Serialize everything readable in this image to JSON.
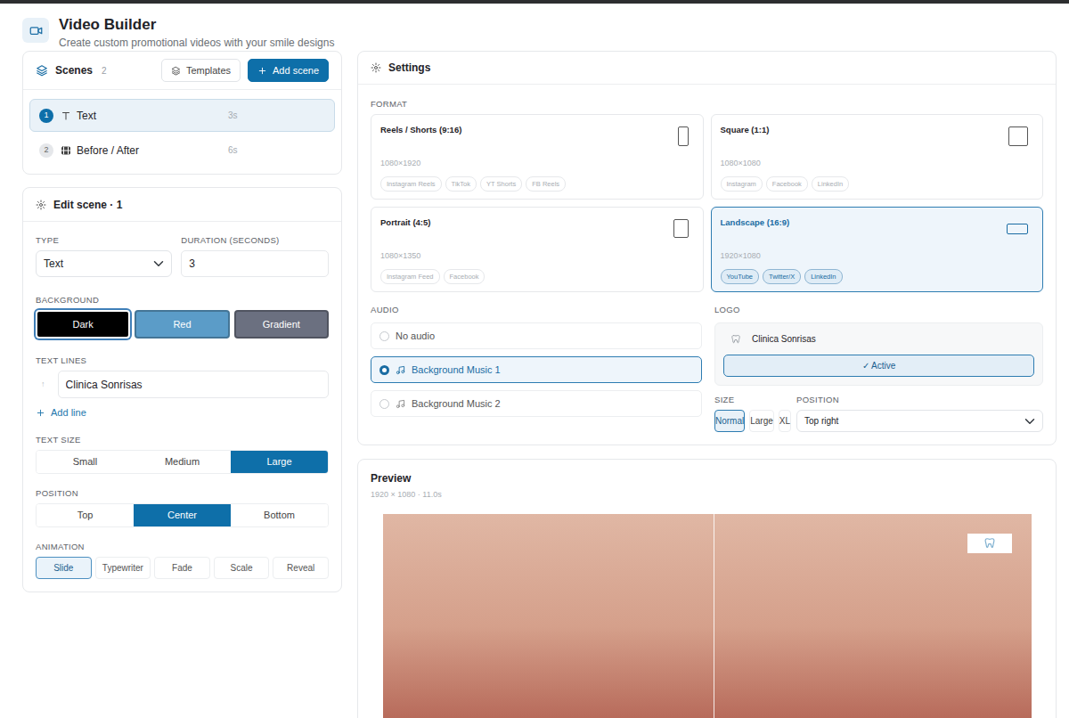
{
  "header": {
    "title": "Video Builder",
    "subtitle": "Create custom promotional videos with your smile designs"
  },
  "scenes": {
    "title": "Scenes",
    "count": "2",
    "templates": "Templates",
    "add": "Add scene",
    "items": [
      {
        "number": "1",
        "label": "Text",
        "duration": "3s",
        "kind": "text",
        "selected": true
      },
      {
        "number": "2",
        "label": "Before / After",
        "duration": "6s",
        "kind": "media",
        "selected": false
      }
    ]
  },
  "edit": {
    "title": "Edit scene · 1",
    "type_label": "TYPE",
    "type_value": "Text",
    "duration_label": "DURATION (SECONDS)",
    "duration_value": "3",
    "background_label": "BACKGROUND",
    "backgrounds": [
      {
        "label": "Dark",
        "color": "#000000",
        "selected": true
      },
      {
        "label": "Red",
        "color": "#5b9cc8",
        "selected": false
      },
      {
        "label": "Gradient",
        "color": "#6b7080",
        "selected": false
      }
    ],
    "text_lines_label": "TEXT LINES",
    "lines": [
      {
        "handle": "↑",
        "value": "Clinica Sonrisas"
      }
    ],
    "add_line": "Add line",
    "text_size_label": "TEXT SIZE",
    "text_sizes": [
      {
        "label": "Small",
        "selected": false
      },
      {
        "label": "Medium",
        "selected": false
      },
      {
        "label": "Large",
        "selected": true
      }
    ],
    "position_label": "POSITION",
    "positions": [
      {
        "label": "Top",
        "selected": false
      },
      {
        "label": "Center",
        "selected": true
      },
      {
        "label": "Bottom",
        "selected": false
      }
    ],
    "animation_label": "ANIMATION",
    "animations": [
      {
        "label": "Slide",
        "selected": true
      },
      {
        "label": "Typewriter",
        "selected": false
      },
      {
        "label": "Fade",
        "selected": false
      },
      {
        "label": "Scale",
        "selected": false
      },
      {
        "label": "Reveal",
        "selected": false
      }
    ]
  },
  "settings": {
    "title": "Settings",
    "format_label": "FORMAT",
    "formats": [
      {
        "name": "Reels / Shorts (9:16)",
        "size": "1080×1920",
        "kind": "tall",
        "selected": false,
        "tags": [
          "Instagram Reels",
          "TikTok",
          "YT Shorts",
          "FB Reels"
        ]
      },
      {
        "name": "Square (1:1)",
        "size": "1080×1080",
        "kind": "square",
        "selected": false,
        "tags": [
          "Instagram",
          "Facebook",
          "LinkedIn"
        ]
      },
      {
        "name": "Portrait (4:5)",
        "size": "1080×1350",
        "kind": "portrait",
        "selected": false,
        "tags": [
          "Instagram Feed",
          "Facebook"
        ]
      },
      {
        "name": "Landscape (16:9)",
        "size": "1920×1080",
        "kind": "wide",
        "selected": true,
        "tags": [
          "YouTube",
          "Twitter/X",
          "LinkedIn"
        ]
      }
    ],
    "audio_label": "AUDIO",
    "audio": [
      {
        "label": "No audio",
        "kind": "none",
        "selected": false
      },
      {
        "label": "Background Music 1",
        "kind": "music",
        "selected": true
      },
      {
        "label": "Background Music 2",
        "kind": "music",
        "selected": false
      }
    ],
    "logo_label": "LOGO",
    "logo": {
      "name": "Clinica Sonrisas",
      "button": "✓ Active",
      "active": true
    },
    "size_label": "SIZE",
    "sizes": [
      {
        "label": "Normal",
        "selected": true
      },
      {
        "label": "Large",
        "selected": false
      },
      {
        "label": "XL",
        "selected": false
      }
    ],
    "position_label": "POSITION",
    "position_value": "Top right"
  },
  "preview": {
    "title": "Preview",
    "meta": "1920 × 1080 · 11.0s",
    "divider": 0.51
  }
}
